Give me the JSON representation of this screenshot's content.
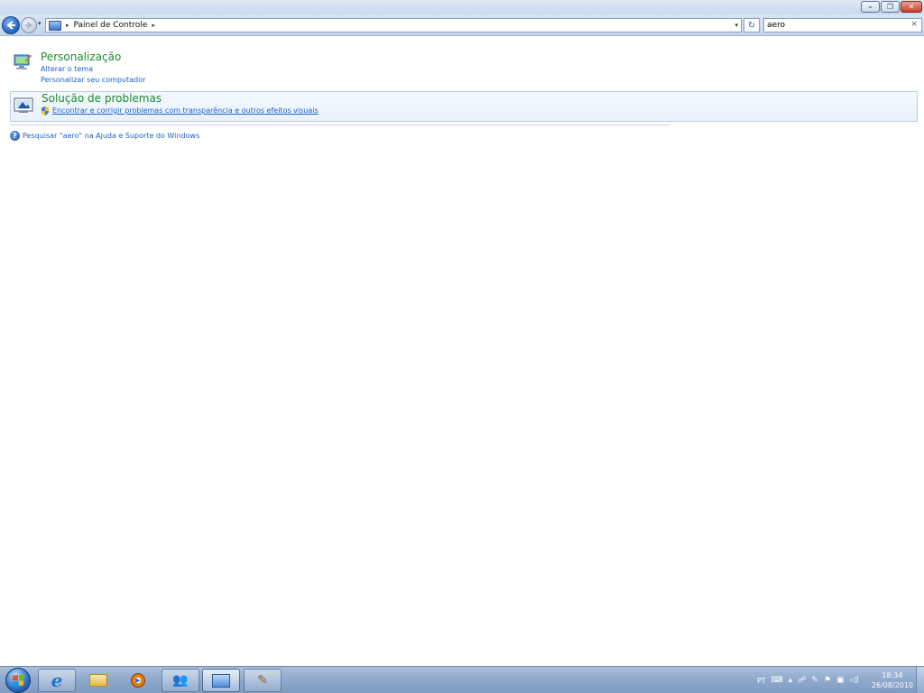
{
  "window": {
    "controls": {
      "minimize": "–",
      "maximize": "❐",
      "close": "✕"
    }
  },
  "navbar": {
    "back_icon": "back-arrow-icon",
    "forward_icon": "forward-arrow-icon",
    "breadcrumb": [
      "Painel de Controle"
    ],
    "separator": "▸",
    "dropdown": "▾",
    "refresh_glyph": "↻",
    "search": {
      "value": "aero",
      "clear_glyph": "×"
    }
  },
  "results": [
    {
      "title": "Personalização",
      "links": [
        "Alterar o tema",
        "Personalizar seu computador"
      ],
      "icon": "personalization-icon"
    },
    {
      "title": "Solução de problemas",
      "links": [
        "Encontrar e corrigir problemas com transparência e outros efeitos visuais"
      ],
      "icon": "troubleshooting-icon",
      "link_icon": "shield-icon"
    }
  ],
  "help": {
    "text": "Pesquisar \"aero\" na Ajuda e Suporte do Windows",
    "icon": "help-icon"
  },
  "taskbar": {
    "apps": [
      {
        "name": "internet-explorer",
        "glyph": "e",
        "state": "running"
      },
      {
        "name": "windows-explorer",
        "glyph": "",
        "state": "idle"
      },
      {
        "name": "media-player",
        "glyph": "▶",
        "state": "idle"
      },
      {
        "name": "live-messenger",
        "glyph": "👥",
        "state": "running"
      },
      {
        "name": "control-panel",
        "glyph": "",
        "state": "active"
      },
      {
        "name": "paint",
        "glyph": "✎",
        "state": "running"
      }
    ],
    "tray": {
      "language": "PT",
      "time": "18:34",
      "date": "26/08/2010"
    }
  },
  "colors": {
    "title_green": "#1e8a2e",
    "link_blue": "#1a61c9",
    "highlight_border": "#b7cce6"
  }
}
